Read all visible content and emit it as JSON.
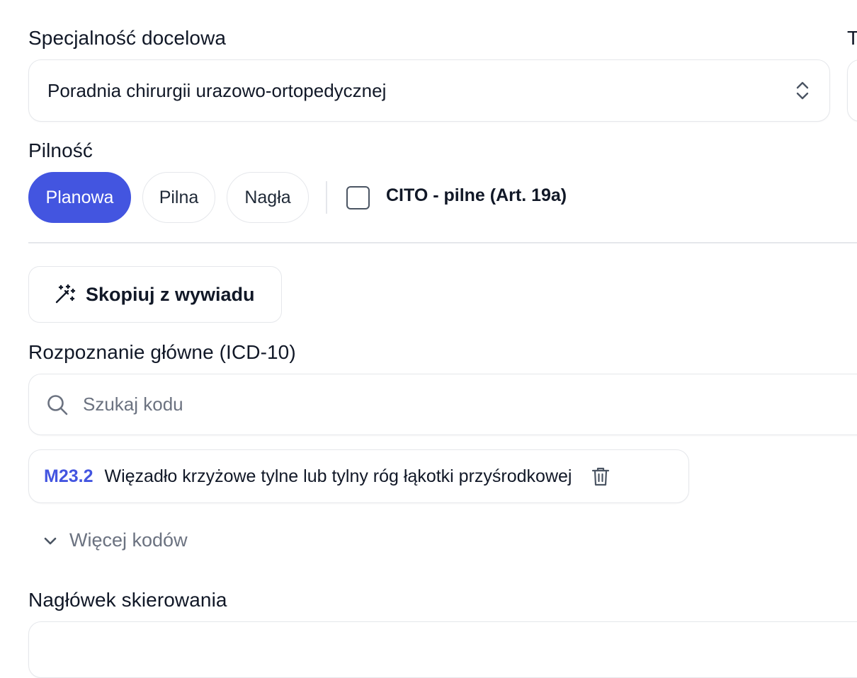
{
  "specialty": {
    "label": "Specjalność docelowa",
    "selected": "Poradnia chirurgii urazowo-ortopedycznej",
    "right_label_partial": "T"
  },
  "urgency": {
    "label": "Pilność",
    "options": [
      "Planowa",
      "Pilna",
      "Nagła"
    ],
    "selected": "Planowa",
    "cito_label": "CITO - pilne (Art. 19a)",
    "cito_checked": false
  },
  "copy_button": {
    "label": "Skopiuj z wywiadu"
  },
  "diagnosis": {
    "label": "Rozpoznanie główne (ICD-10)",
    "search_placeholder": "Szukaj kodu",
    "selected_code": "M23.2",
    "selected_description": "Więzadło krzyżowe tylne lub tylny róg łąkotki przyśrodkowej",
    "more_codes_label": "Więcej kodów"
  },
  "header_section": {
    "label": "Nagłówek skierowania"
  },
  "colors": {
    "accent": "#4355e0",
    "code": "#4355e0",
    "border": "#e5e7eb",
    "muted": "#6b7280"
  }
}
